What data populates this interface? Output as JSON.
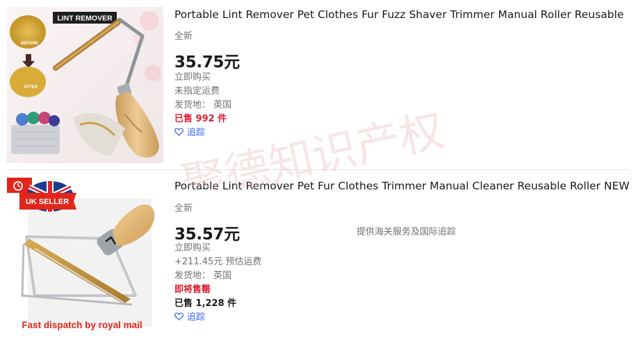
{
  "listings": [
    {
      "image": {
        "banner": "LINT REMOVER",
        "before": "BEFORE",
        "after": "AFTER"
      },
      "title": "Portable Lint Remover Pet Clothes Fur Fuzz Shaver Trimmer Manual Roller Reusable",
      "condition": "全新",
      "price": "35.75元",
      "buy_format": "立即购买",
      "shipping": "未指定运费",
      "location": "发货地： 英国",
      "sold": "已售 992 件",
      "watch": "追踪"
    },
    {
      "image": {
        "banner": "UK SELLER",
        "caption": "Fast dispatch by royal mail"
      },
      "title": "Portable Lint Remover Pet Fur Clothes Trimmer Manual Cleaner Reusable Roller NEW",
      "condition": "全新",
      "price": "35.57元",
      "buy_format": "立即购买",
      "shipping": "+211.45元 预估运费",
      "location": "发货地： 英国",
      "urgency": "即将售罄",
      "sold": "已售 1,228 件",
      "watch": "追踪",
      "customs_note": "提供海关服务及国际追踪"
    }
  ],
  "watermark": "聚德知识产权",
  "colors": {
    "link_blue": "#3665f3",
    "urgent_red": "#dd1e31",
    "secondary_text": "#707070",
    "primary_text": "#191919"
  }
}
